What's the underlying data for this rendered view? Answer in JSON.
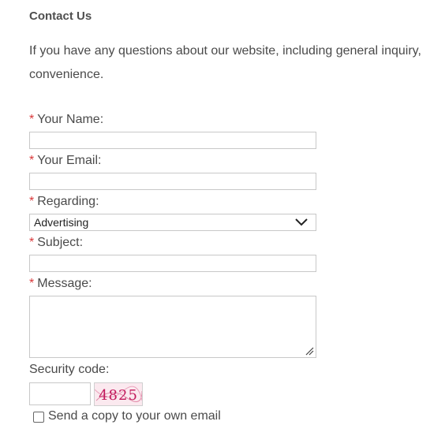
{
  "page": {
    "title": "Contact Us",
    "intro_line1": "If you have any questions about our website, including general inquiry,",
    "intro_line2": "convenience."
  },
  "form": {
    "required_mark": "*",
    "name_label": "Your Name:",
    "email_label": "Your Email:",
    "regarding_label": "Regarding:",
    "regarding_value": "Advertising",
    "subject_label": "Subject:",
    "message_label": "Message:",
    "security_label": "Security code:",
    "captcha_text": "4825",
    "copy_label": "Send a copy to your own email"
  },
  "colors": {
    "required": "#d9383a",
    "text": "#4a4a4a",
    "captcha_ink": "#c2185b"
  },
  "icons": {
    "select": "chevron-down-icon",
    "textarea": "resize-grip-icon"
  }
}
